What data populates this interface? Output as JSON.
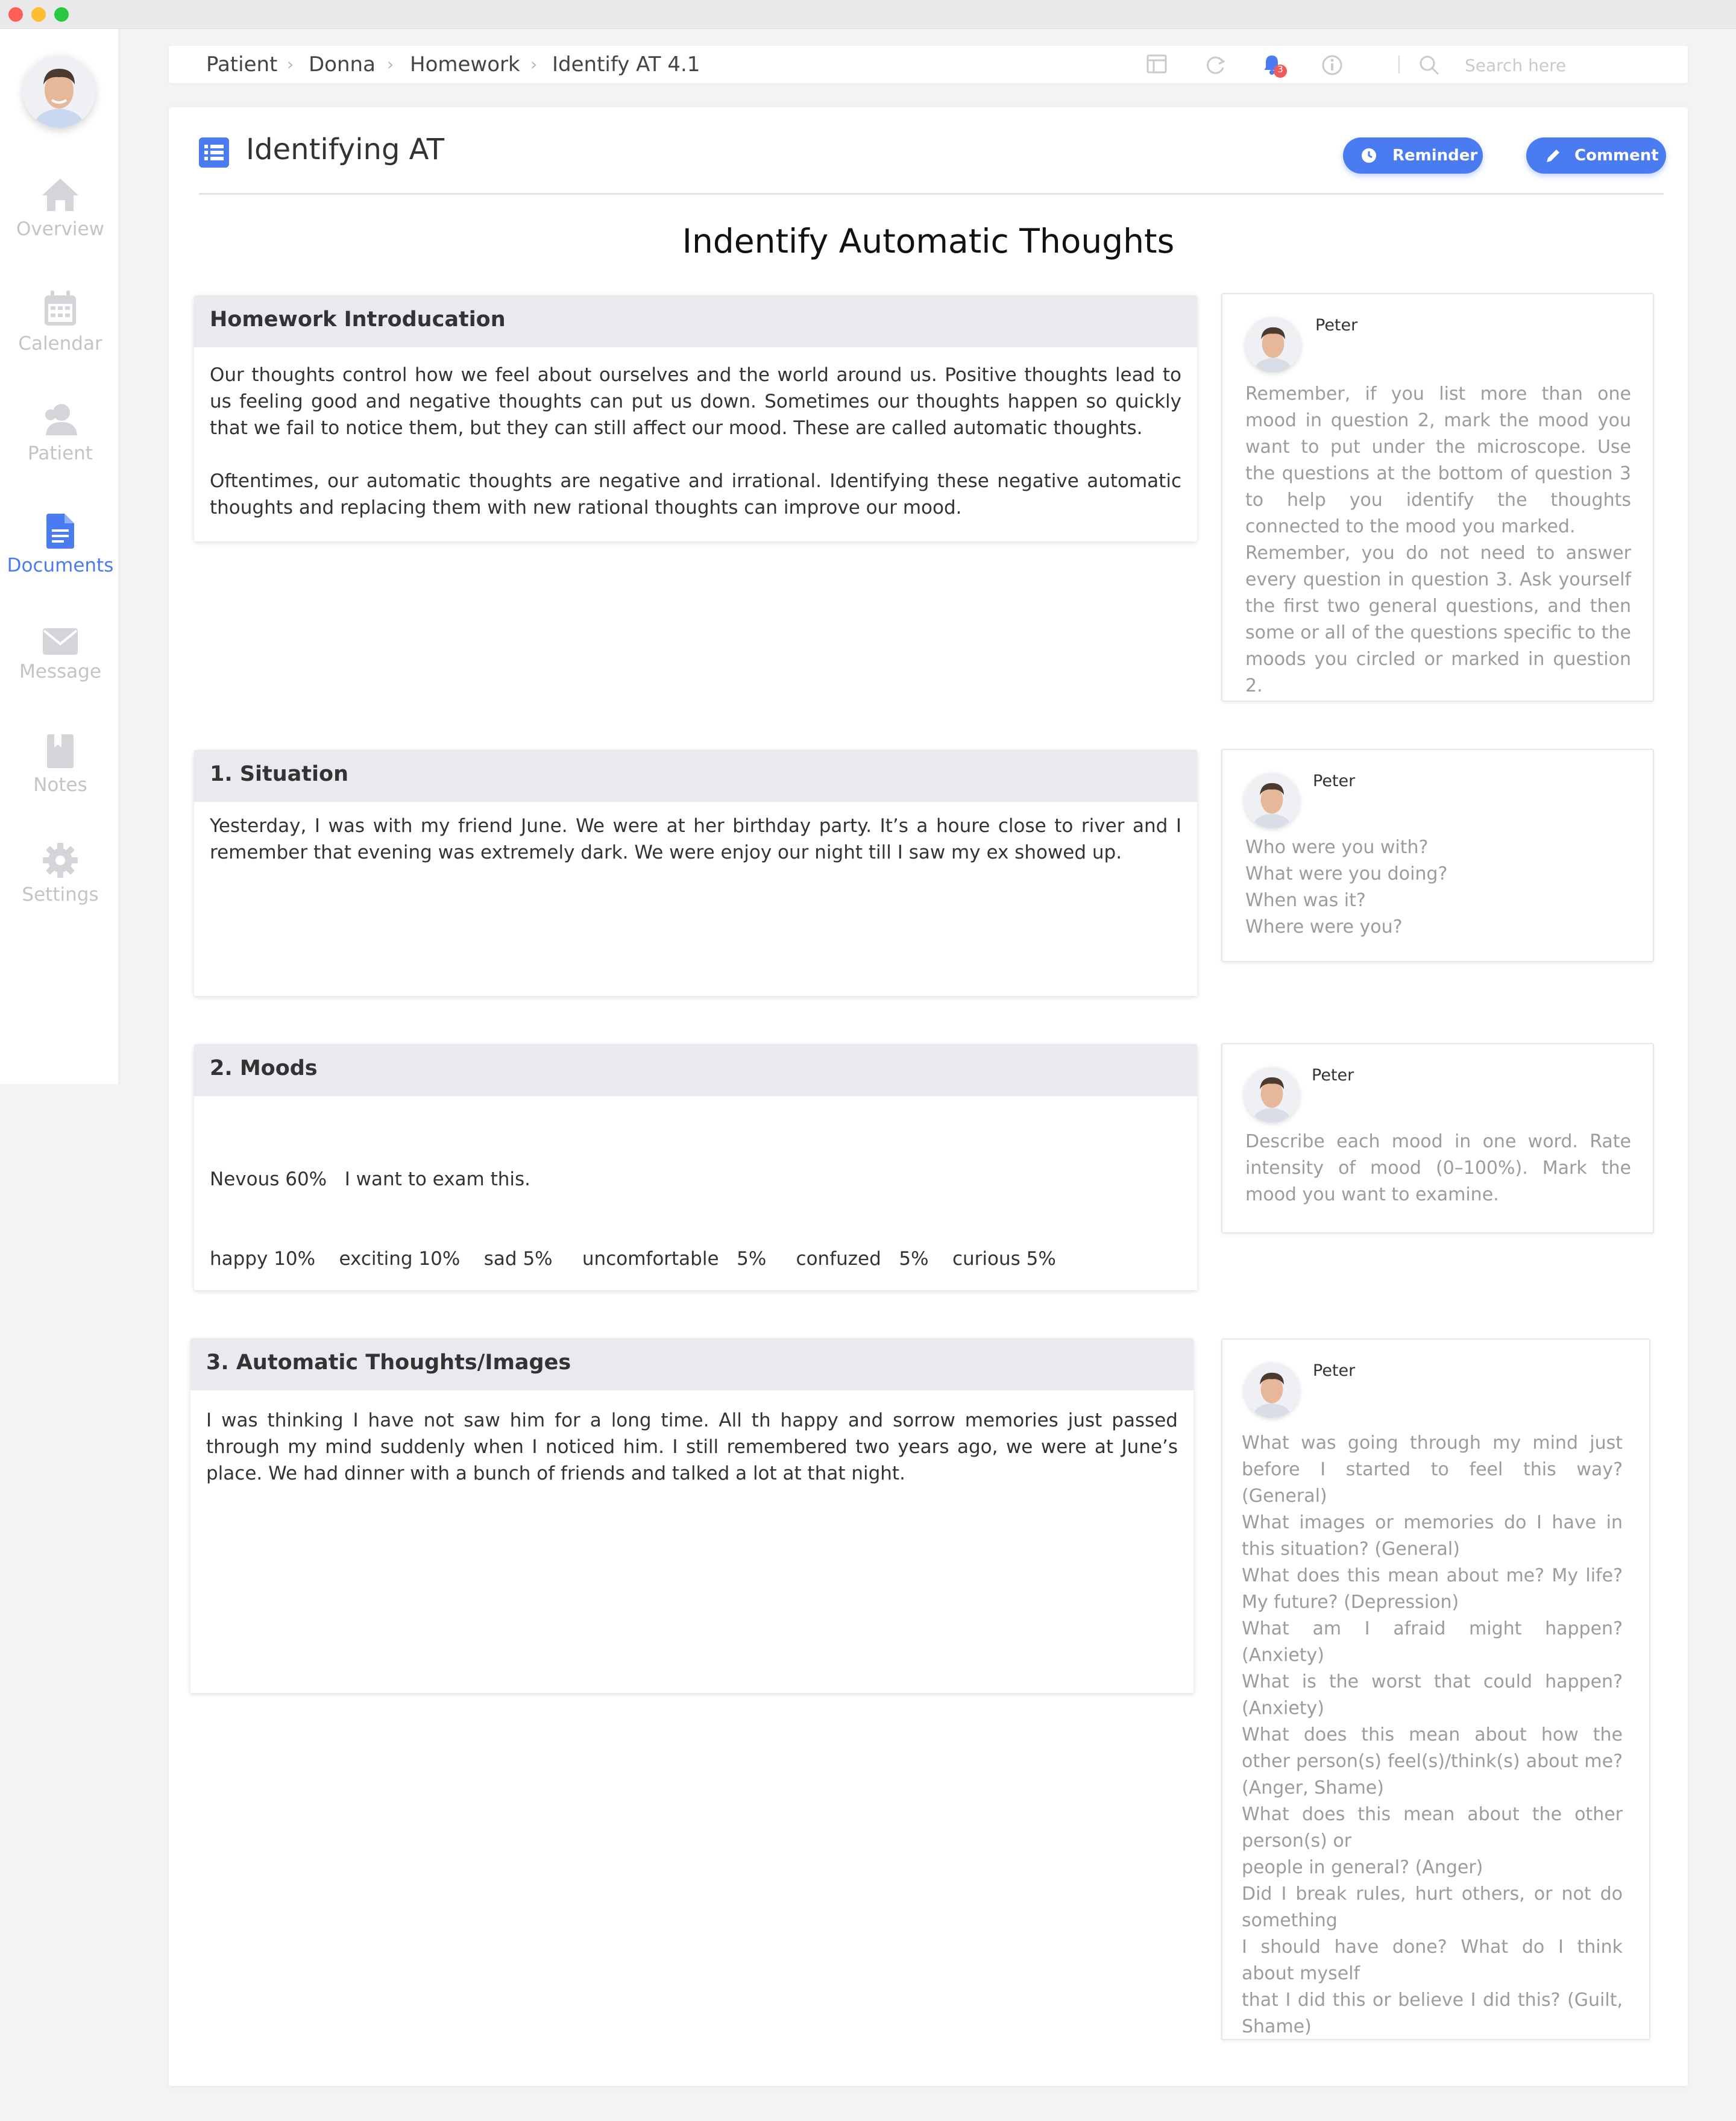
{
  "window": {
    "controls": [
      "close",
      "minimize",
      "maximize"
    ]
  },
  "sidebar": {
    "items": [
      {
        "label": "Overview",
        "icon": "home-icon"
      },
      {
        "label": "Calendar",
        "icon": "calendar-icon"
      },
      {
        "label": "Patient",
        "icon": "user-icon"
      },
      {
        "label": "Documents",
        "icon": "document-icon",
        "active": true
      },
      {
        "label": "Message",
        "icon": "envelope-icon"
      },
      {
        "label": "Notes",
        "icon": "bookmark-icon"
      },
      {
        "label": "Settings",
        "icon": "gear-icon"
      }
    ]
  },
  "breadcrumb": [
    "Patient",
    "Donna",
    "Homework",
    "Identify AT 4.1"
  ],
  "toolbar": {
    "notification_count": "3",
    "search_placeholder": "Search here"
  },
  "page": {
    "title": "Identifying AT",
    "reminder_label": "Reminder",
    "comment_label": "Comment",
    "heading": "Indentify Automatic Thoughts"
  },
  "sections": [
    {
      "title": "Homework Introducation",
      "paragraphs": [
        "Our thoughts control how we feel about ourselves and the world around us. Positive thoughts lead to us feeling good and negative thoughts can put us down. Sometimes our thoughts happen so quickly that we fail to notice them, but they can still affect our mood. These are called automatic thoughts.",
        "Oftentimes, our automatic thoughts are negative and irrational. Identifying these negative automatic thoughts and replacing them with new rational thoughts can improve our mood."
      ]
    },
    {
      "title": "1. Situation",
      "paragraphs": [
        "Yesterday, I was with my friend June. We were at her birthday party.  It’s a houre close to river and I remember that evening was extremely dark. We were enjoy our night till I saw my ex showed up."
      ]
    },
    {
      "title": "2. Moods",
      "lines": [
        "Nevous 60%   I want to exam this.",
        "happy 10%    exciting 10%    sad 5%     uncomfortable   5%     confuzed   5%    curious 5%"
      ]
    },
    {
      "title": "3. Automatic Thoughts/Images",
      "paragraphs": [
        "I was thinking I have not saw him for a long time. All th happy and sorrow memories just passed through my mind suddenly when I noticed him. I still remembered two years ago, we were at June’s place. We had dinner with a bunch of friends and talked a lot at that night."
      ]
    }
  ],
  "comments": [
    {
      "author": "Peter",
      "text": "Remember, if you list more than one mood in question 2,  mark the mood you want to put under the microscope. Use the questions at the bottom of question 3 to help you identify the thoughts connected to the mood you marked.\nRemember, you do not need to answer every question in question 3. Ask yourself the first two general questions, and then some or all of the questions specific to the moods you circled or marked in question 2."
    },
    {
      "author": "Peter",
      "text": "Who were you with?\nWhat were you doing?\nWhen was it?\nWhere were you?"
    },
    {
      "author": "Peter",
      "text": "Describe each mood in one word. Rate intensity of mood (0–100%). Mark the mood you want to examine."
    },
    {
      "author": "Peter",
      "text": "What was going through my mind just before I started to feel this way? (General)\nWhat images or memories do I have in this situation? (General)\nWhat does this mean about me? My life? My future? (Depression)\nWhat am I afraid might happen? (Anxiety)\nWhat is the worst that could happen? (Anxiety)\nWhat does this mean about how the other person(s) feel(s)/think(s) about me? (Anger, Shame)\nWhat does this mean about the other person(s) or\npeople in general? (Anger)\nDid I break rules, hurt others, or not do something\nI should have done? What do I think about myself\nthat I did this or believe I did this? (Guilt, Shame)"
    }
  ]
}
